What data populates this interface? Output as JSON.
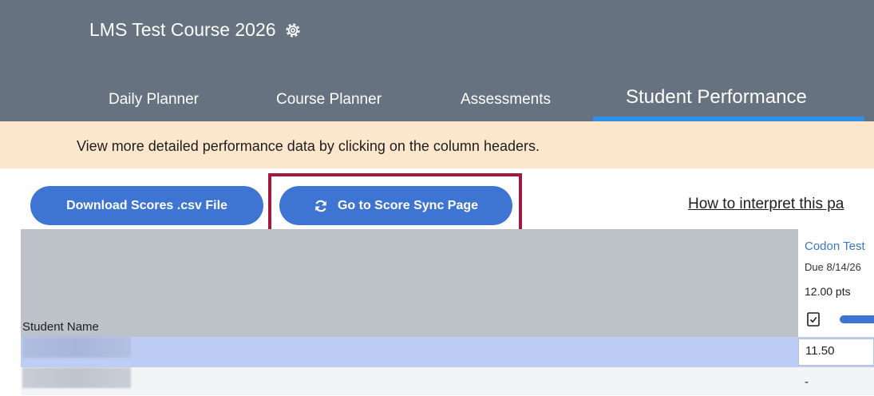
{
  "header": {
    "course_title": "LMS Test Course 2026",
    "background": "#667280"
  },
  "tabs": [
    {
      "label": "Daily Planner",
      "active": false
    },
    {
      "label": "Course Planner",
      "active": false
    },
    {
      "label": "Assessments",
      "active": false
    },
    {
      "label": "Student Performance",
      "active": true
    }
  ],
  "banner": {
    "text": "View more detailed performance data by clicking on the column headers."
  },
  "actions": {
    "download_label": "Download Scores .csv File",
    "sync_label": "Go to Score Sync Page",
    "interpret_link": "How to interpret this pa"
  },
  "grid": {
    "student_name_header": "Student Name",
    "assessment": {
      "name": "Codon Test",
      "due": "Due 8/14/26",
      "points": "12.00 pts"
    },
    "rows": [
      {
        "score": "11.50"
      },
      {
        "score": "-"
      }
    ]
  },
  "colors": {
    "accent": "#3f75d2",
    "highlight": "#a11a3e",
    "banner": "#fde7cc"
  }
}
